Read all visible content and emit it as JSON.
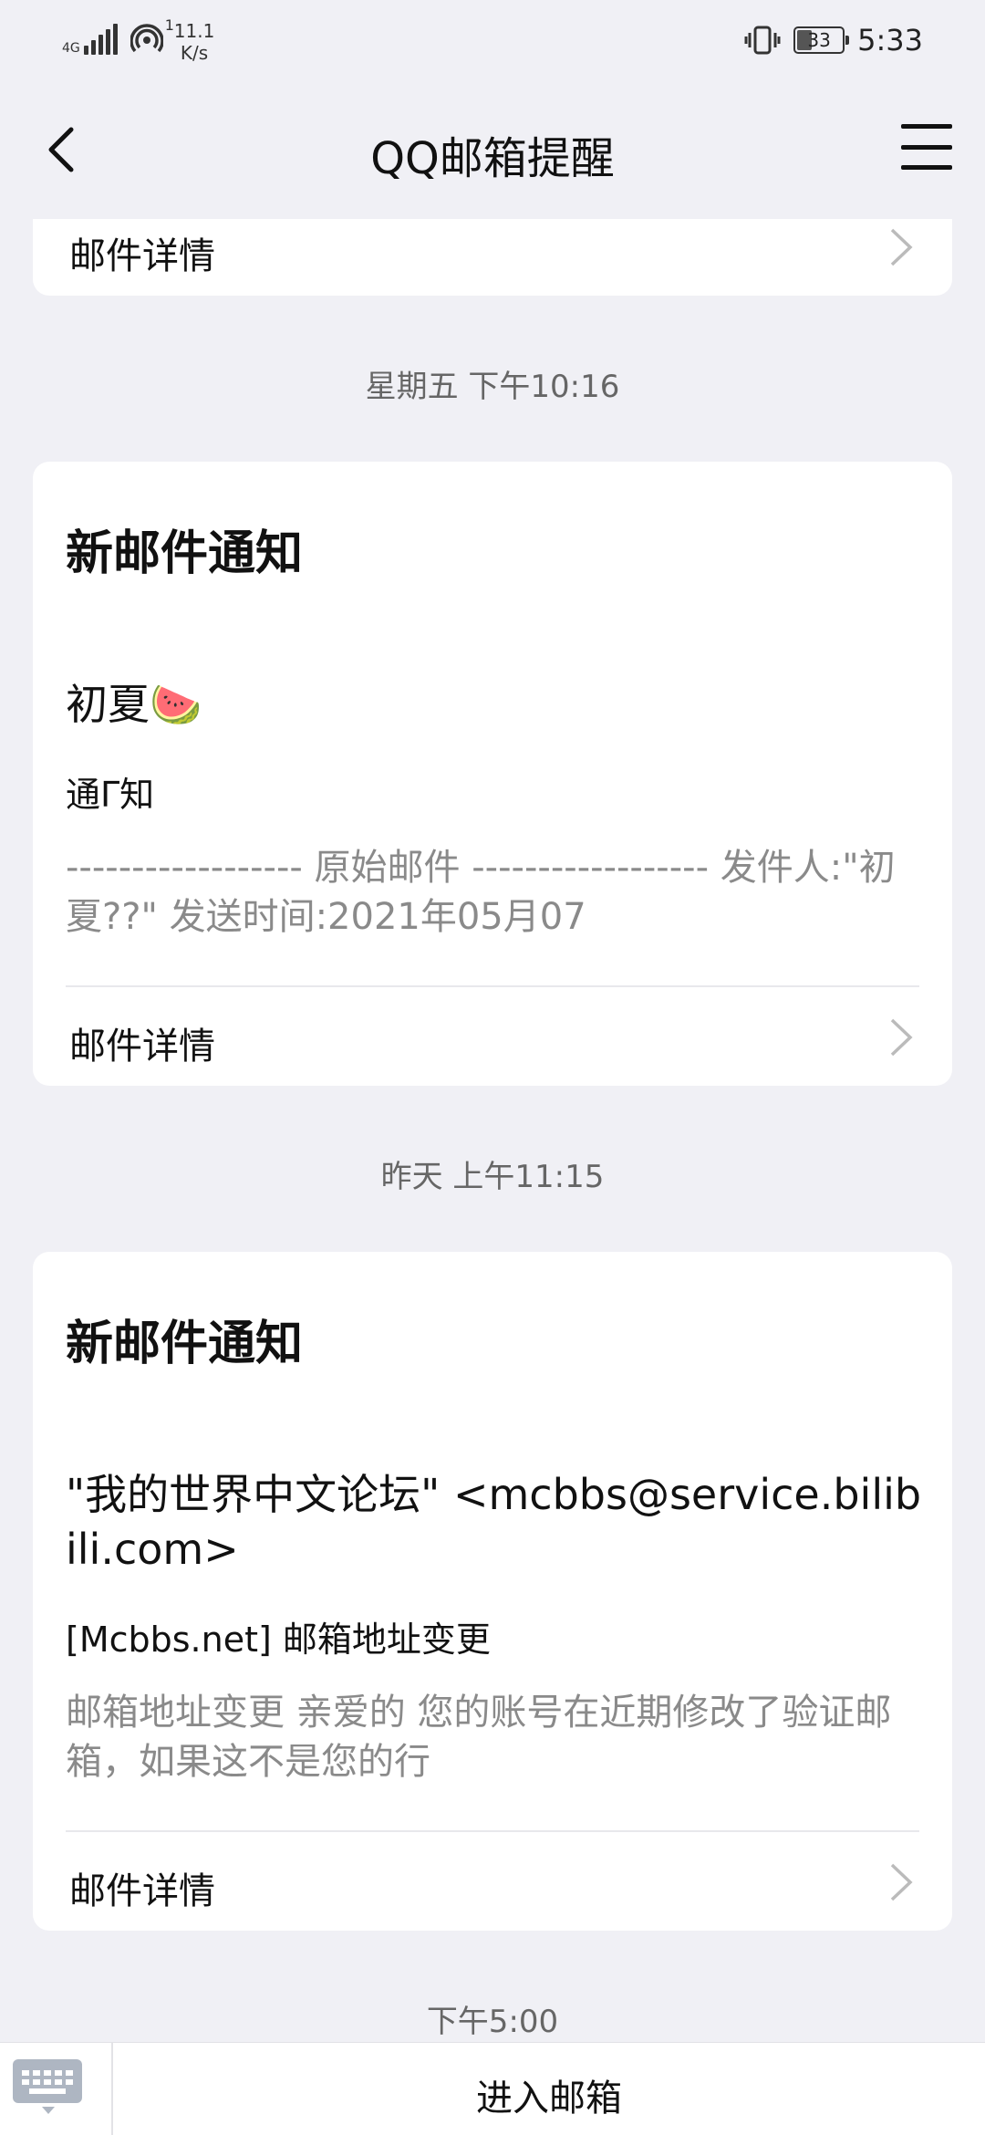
{
  "status_bar": {
    "network": "4G",
    "sim_index": "1",
    "speed_value": "11.1",
    "speed_unit": "K/s",
    "battery": "33",
    "time": "5:33"
  },
  "nav": {
    "title": "QQ邮箱提醒"
  },
  "cards": [
    {
      "detail_label": "邮件详情"
    },
    {
      "timestamp": "星期五 下午10:16",
      "title": "新邮件通知",
      "sender": "初夏🍉",
      "subject": "通Γ知",
      "preview": "------------------ 原始邮件 ------------------ 发件人:\"初夏??\" 发送时间:2021年05月07",
      "detail_label": "邮件详情"
    },
    {
      "timestamp": "昨天 上午11:15",
      "title": "新邮件通知",
      "sender": "\"我的世界中文论坛\" <mcbbs@service.bilibili.com>",
      "subject": "[Mcbbs.net] 邮箱地址变更",
      "preview": "邮箱地址变更 亲爱的 您的账号在近期修改了验证邮箱，如果这不是您的行",
      "detail_label": "邮件详情"
    }
  ],
  "last_timestamp": "下午5:00",
  "bottom_bar": {
    "enter_mail_label": "进入邮箱"
  }
}
